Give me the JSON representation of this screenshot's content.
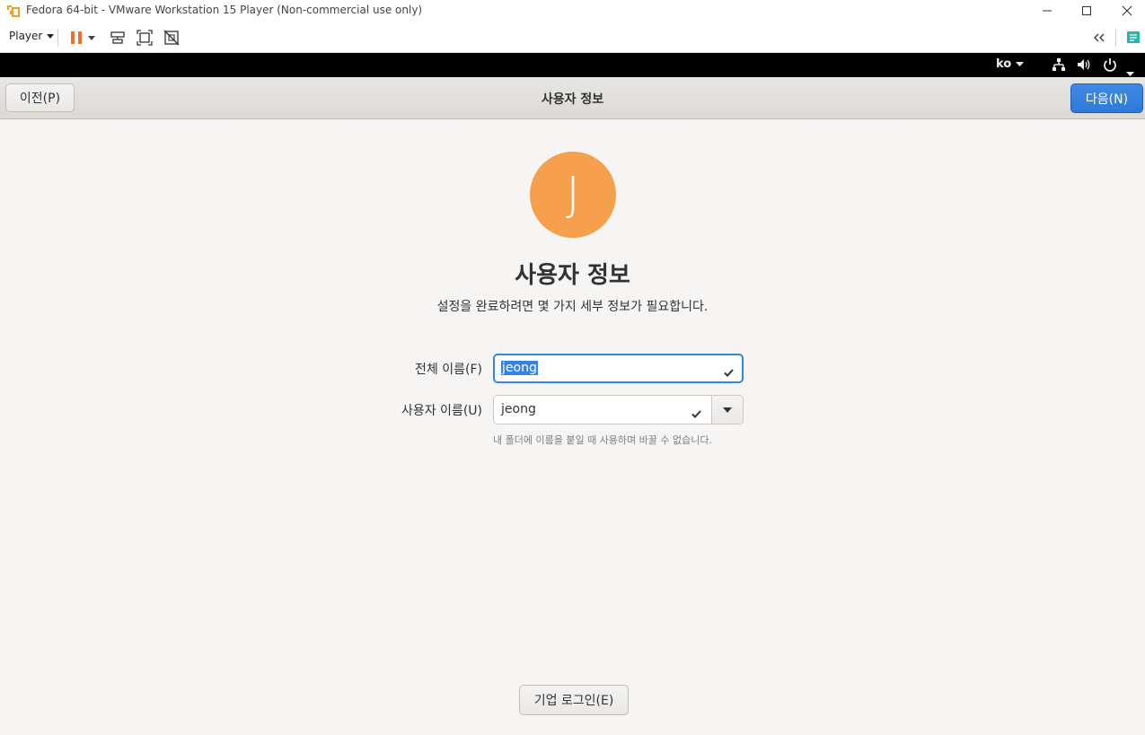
{
  "window": {
    "title": "Fedora 64-bit - VMware Workstation 15 Player (Non-commercial use only)",
    "icon": "vmware-player-icon"
  },
  "vm_toolbar": {
    "player_menu_label": "Player",
    "pause_color": "#e8742c"
  },
  "gnome_topbar": {
    "language": "ko"
  },
  "headerbar": {
    "prev_label": "이전(P)",
    "title": "사용자 정보",
    "next_label": "다음(N)",
    "next_color": "#3584e4"
  },
  "main": {
    "avatar_initial": "J",
    "avatar_color": "#f6a04d",
    "heading": "사용자 정보",
    "subheading": "설정을 완료하려면 몇 가지 세부 정보가 필요합니다.",
    "full_name_label": "전체 이름(F)",
    "full_name_value": "jeong",
    "username_label": "사용자 이름(U)",
    "username_value": "jeong",
    "username_hint": "내 폴더에 이름을 붙일 때 사용하며 바꿀 수 없습니다.",
    "enterprise_login_label": "기업 로그인(E)"
  }
}
